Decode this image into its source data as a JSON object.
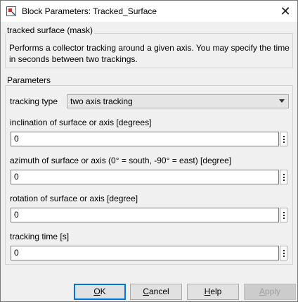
{
  "window": {
    "title": "Block Parameters: Tracked_Surface",
    "icon": "simulink-block-icon",
    "close_icon": "close-icon"
  },
  "mask": {
    "legend": "tracked surface (mask)",
    "description": "Performs a collector tracking around a given axis. You may specify the time in seconds between two trackings."
  },
  "parameters": {
    "legend": "Parameters",
    "tracking_type": {
      "label": "tracking type",
      "value": "two axis tracking"
    },
    "inclination": {
      "label": "inclination of surface or axis [degrees]",
      "value": "0"
    },
    "azimuth": {
      "label": "azimuth of surface or axis (0° = south, -90° = east) [degree]",
      "value": "0"
    },
    "rotation": {
      "label": "rotation of surface or axis [degree]",
      "value": "0"
    },
    "tracking_time": {
      "label": "tracking time [s]",
      "value": "0"
    }
  },
  "buttons": {
    "ok": {
      "mnemonic": "O",
      "rest": "K"
    },
    "cancel": {
      "mnemonic": "C",
      "rest": "ancel"
    },
    "help": {
      "mnemonic": "H",
      "rest": "elp"
    },
    "apply": {
      "mnemonic": "A",
      "rest": "pply"
    }
  }
}
